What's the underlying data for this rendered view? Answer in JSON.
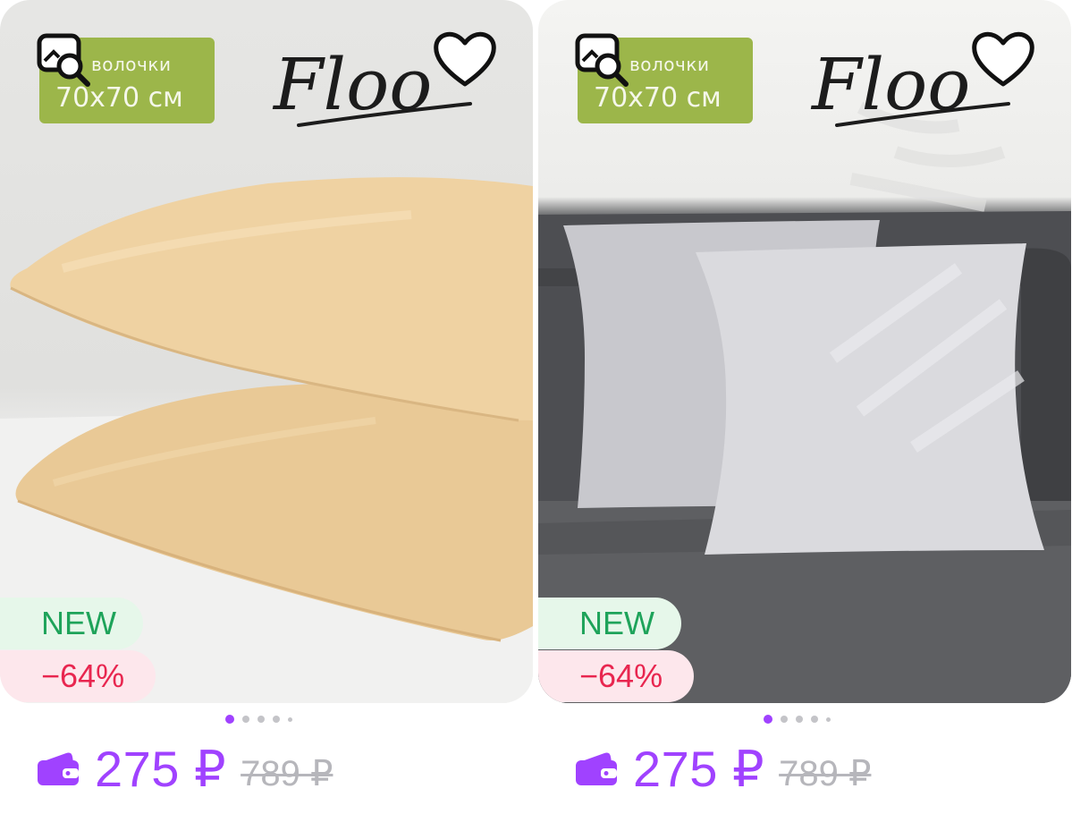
{
  "products": [
    {
      "scene": "beige",
      "size_tag_line1": "волочки",
      "size_tag_line2": "70x70 см",
      "brand": "Floo",
      "badge_new": "NEW",
      "badge_discount": "−64%",
      "price": "275 ₽",
      "old_price": "789 ₽",
      "images_total": 5,
      "active_image": 1
    },
    {
      "scene": "sofa",
      "size_tag_line1": "волочки",
      "size_tag_line2": "70x70 см",
      "brand": "Floo",
      "badge_new": "NEW",
      "badge_discount": "−64%",
      "price": "275 ₽",
      "old_price": "789 ₽",
      "images_total": 5,
      "active_image": 1
    }
  ],
  "icons": {
    "zoom": "image-search-icon",
    "favorite": "heart-outline-icon",
    "wallet": "wallet-icon"
  },
  "colors": {
    "price": "#a042ff",
    "new_badge_text": "#1ea35a",
    "new_badge_bg": "#e6f7ea",
    "discount_text": "#e8264f",
    "discount_bg": "#fde7ec",
    "old_price": "#b6b6bb",
    "size_tag_bg": "#9cb64a"
  }
}
